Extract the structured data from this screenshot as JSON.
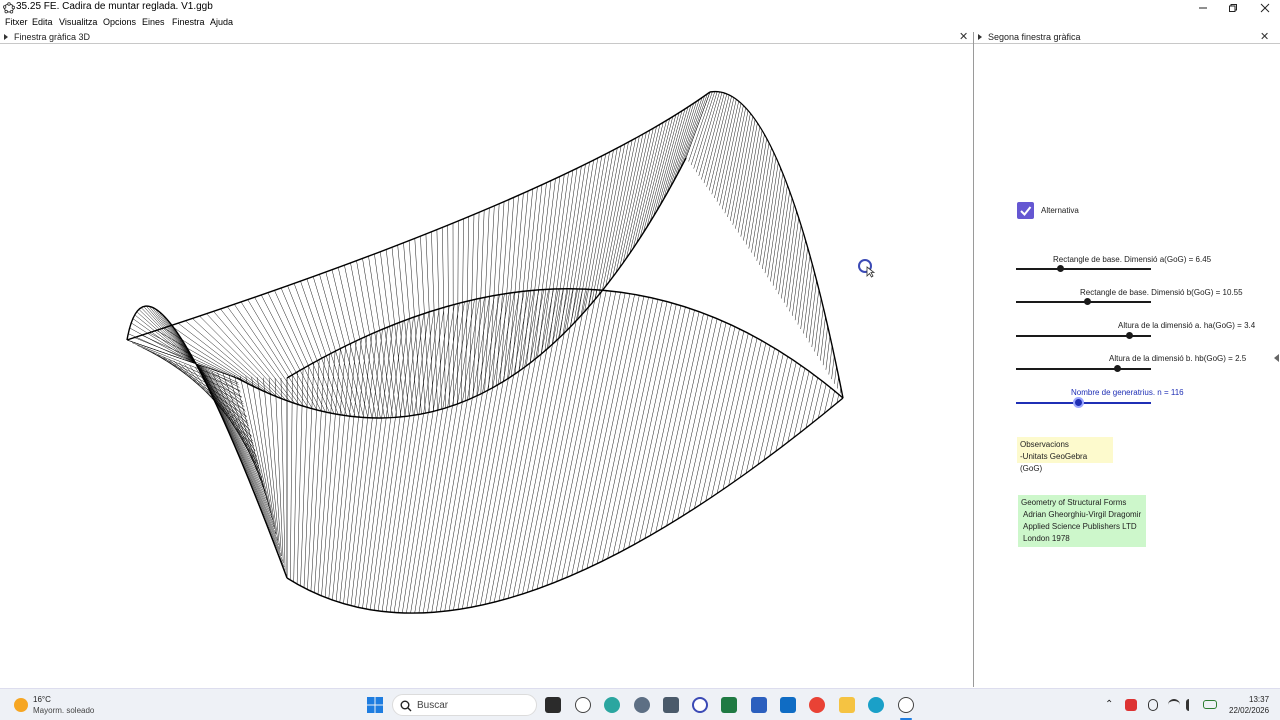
{
  "window": {
    "title": "35.25 FE. Cadira de muntar reglada. V1.ggb"
  },
  "menu": [
    "Fitxer",
    "Edita",
    "Visualitza",
    "Opcions",
    "Eines",
    "Finestra",
    "Ajuda"
  ],
  "panels": {
    "view3d_title": "Finestra gràfica 3D",
    "graphics2_title": "Segona finestra gràfica"
  },
  "checkbox": {
    "label": "Alternativa",
    "checked": true
  },
  "sliders": [
    {
      "label": "Rectangle de base. Dimensió a(GoG) = 6.45",
      "fraction": 0.33
    },
    {
      "label": "Rectangle de base. Dimensió b(GoG) = 10.55",
      "fraction": 0.53
    },
    {
      "label": "Altura de la dimensió a. ha(GoG) = 3.4",
      "fraction": 0.84
    },
    {
      "label": "Altura de la dimensió b. hb(GoG) = 2.5",
      "fraction": 0.75
    },
    {
      "label": "Nombre de generatrius. n = 116",
      "fraction": 0.46
    }
  ],
  "observations": {
    "title": "Observacions",
    "line1": "-Unitats GeoGebra (GoG)"
  },
  "reference": {
    "line1": "Geometry of Structural Forms",
    "line2": "Adrian Gheorghiu-Virgil Dragomir",
    "line3": "Applied Science Publishers LTD",
    "line4": "London 1978"
  },
  "taskbar": {
    "weather_temp": "16°C",
    "weather_desc": "Mayorm. soleado",
    "search_label": "Buscar",
    "time": "13:37",
    "date": "22/02/2026"
  },
  "colors": {
    "checkbox": "#6557d2",
    "active_slider": "#1f2fb5",
    "obs_box": "#fdfacd",
    "ref_box": "#cdf7cb"
  }
}
